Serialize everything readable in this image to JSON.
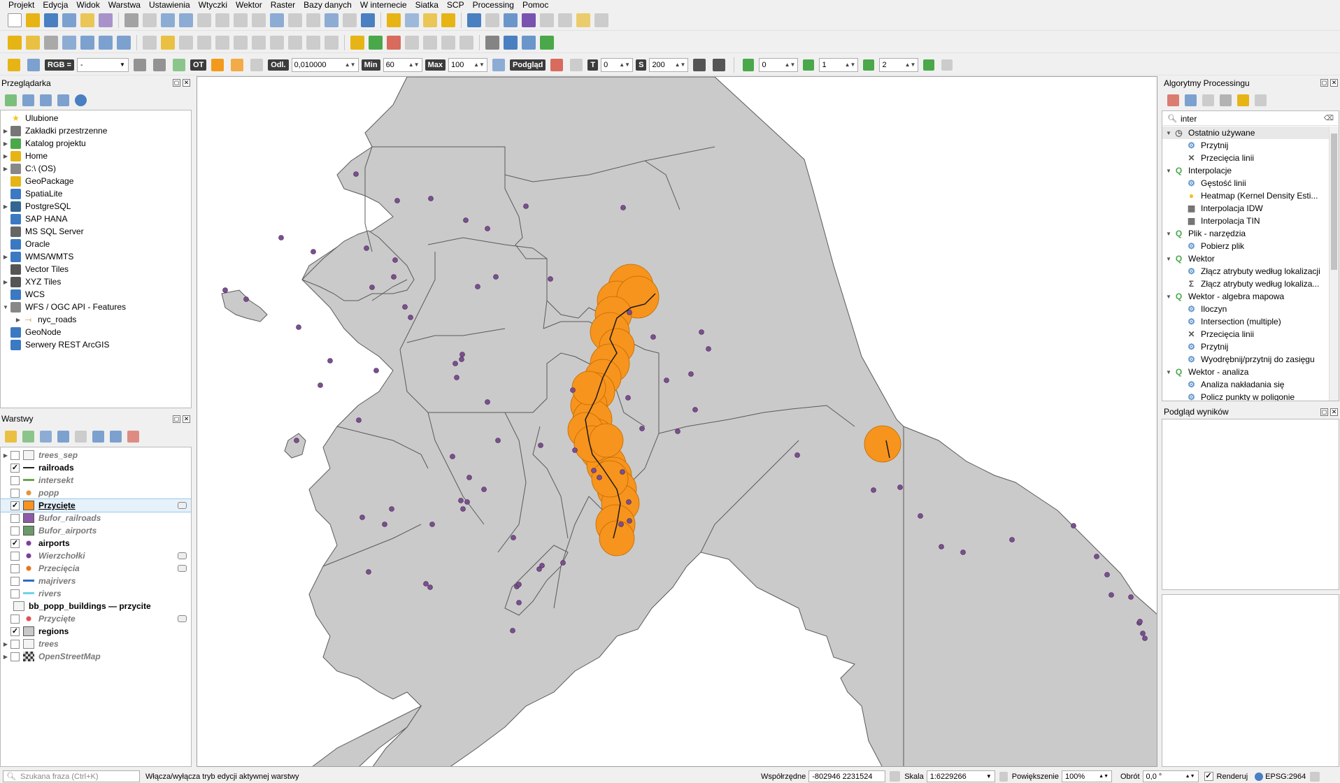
{
  "menu": [
    "Projekt",
    "Edycja",
    "Widok",
    "Warstwa",
    "Ustawienia",
    "Wtyczki",
    "Wektor",
    "Raster",
    "Bazy danych",
    "W internecie",
    "Siatka",
    "SCP",
    "Processing",
    "Pomoc"
  ],
  "toolbar3": {
    "rgb_label": "RGB =",
    "rgb_value": "-",
    "ot_label": "OT",
    "odl_label": "Odl.",
    "odl_value": "0,010000",
    "min_label": "Min",
    "min_value": "60",
    "max_label": "Max",
    "max_value": "100",
    "podglad_label": "Podgląd",
    "t_label": "T",
    "t_value": "0",
    "s_label": "S",
    "s_value": "200",
    "field_a": "0",
    "field_b": "1",
    "field_c": "2"
  },
  "browser": {
    "title": "Przeglądarka",
    "items": [
      {
        "label": "Ulubione",
        "icon": "star-icon",
        "expandable": false
      },
      {
        "label": "Zakładki przestrzenne",
        "icon": "bookmark-icon",
        "expandable": true
      },
      {
        "label": "Katalog projektu",
        "icon": "project-folder-icon",
        "expandable": true
      },
      {
        "label": "Home",
        "icon": "folder-icon",
        "expandable": true
      },
      {
        "label": "C:\\ (OS)",
        "icon": "drive-icon",
        "expandable": true
      },
      {
        "label": "GeoPackage",
        "icon": "geopackage-icon",
        "expandable": false
      },
      {
        "label": "SpatiaLite",
        "icon": "spatialite-icon",
        "expandable": false
      },
      {
        "label": "PostgreSQL",
        "icon": "postgresql-icon",
        "expandable": true
      },
      {
        "label": "SAP HANA",
        "icon": "sap-hana-icon",
        "expandable": false
      },
      {
        "label": "MS SQL Server",
        "icon": "mssql-icon",
        "expandable": false
      },
      {
        "label": "Oracle",
        "icon": "oracle-icon",
        "expandable": false
      },
      {
        "label": "WMS/WMTS",
        "icon": "wms-icon",
        "expandable": true
      },
      {
        "label": "Vector Tiles",
        "icon": "vector-tiles-icon",
        "expandable": false
      },
      {
        "label": "XYZ Tiles",
        "icon": "xyz-tiles-icon",
        "expandable": true
      },
      {
        "label": "WCS",
        "icon": "wcs-icon",
        "expandable": false
      },
      {
        "label": "WFS / OGC API - Features",
        "icon": "wfs-icon",
        "expandable": true,
        "expanded": true
      },
      {
        "label": "nyc_roads",
        "icon": "line-layer-icon",
        "expandable": true,
        "child": true
      },
      {
        "label": "GeoNode",
        "icon": "geonode-icon",
        "expandable": false
      },
      {
        "label": "Serwery REST ArcGIS",
        "icon": "arcgis-icon",
        "expandable": false
      }
    ]
  },
  "layers": {
    "title": "Warstwy",
    "items": [
      {
        "label": "trees_sep",
        "checked": false,
        "style": "normal",
        "icon": "group",
        "color": "#888888",
        "expand": true
      },
      {
        "label": "railroads",
        "checked": true,
        "style": "bold",
        "icon": "rail",
        "color": "#222222"
      },
      {
        "label": "intersekt",
        "checked": false,
        "style": "ital",
        "icon": "line",
        "color": "#6aa84f"
      },
      {
        "label": "popp",
        "checked": false,
        "style": "ital",
        "icon": "dot",
        "color": "#e69138"
      },
      {
        "label": "Przycięte",
        "checked": true,
        "style": "bold-u",
        "icon": "fill",
        "color": "#f7931e",
        "indicator": true,
        "selected": true
      },
      {
        "label": "Bufor_railroads",
        "checked": false,
        "style": "ital",
        "icon": "fill",
        "color": "#8e5aa8"
      },
      {
        "label": "Bufor_airports",
        "checked": false,
        "style": "ital",
        "icon": "fill",
        "color": "#6a9a6a"
      },
      {
        "label": "airports",
        "checked": true,
        "style": "bold",
        "icon": "dot",
        "color": "#7b3f98"
      },
      {
        "label": "Wierzchołki",
        "checked": false,
        "style": "ital",
        "icon": "dot",
        "color": "#7b3f98",
        "indicator": true
      },
      {
        "label": "Przecięcia",
        "checked": false,
        "style": "ital",
        "icon": "dot",
        "color": "#e8741b",
        "indicator": true
      },
      {
        "label": "majrivers",
        "checked": false,
        "style": "ital",
        "icon": "line",
        "color": "#2a6dc8"
      },
      {
        "label": "rivers",
        "checked": false,
        "style": "ital",
        "icon": "line",
        "color": "#6fd3e8"
      },
      {
        "label": "bb_popp_buildings — przycite",
        "checked": null,
        "style": "bold",
        "icon": "group2",
        "color": "#888888"
      },
      {
        "label": "Przycięte",
        "checked": false,
        "style": "ital",
        "icon": "dot",
        "color": "#e05050",
        "indicator": true
      },
      {
        "label": "regions",
        "checked": true,
        "style": "bold",
        "icon": "fill",
        "color": "#c8c8c8"
      },
      {
        "label": "trees",
        "checked": false,
        "style": "ital",
        "icon": "group",
        "color": "#888888",
        "expand": true
      },
      {
        "label": "OpenStreetMap",
        "checked": false,
        "style": "ital",
        "icon": "osm",
        "color": "#555555",
        "expand": true
      }
    ]
  },
  "processing": {
    "title": "Algorytmy Processingu",
    "search_value": "inter",
    "items": [
      {
        "label": "Ostatnio używane",
        "level": 0,
        "icon": "clock-icon",
        "expand": "open",
        "highlight": true
      },
      {
        "label": "Przytnij",
        "level": 1,
        "icon": "gear-icon"
      },
      {
        "label": "Przecięcia linii",
        "level": 1,
        "icon": "cross-lines-icon"
      },
      {
        "label": "Interpolacje",
        "level": 0,
        "icon": "qgis-icon",
        "expand": "open"
      },
      {
        "label": "Gęstość linii",
        "level": 1,
        "icon": "gear-icon"
      },
      {
        "label": "Heatmap (Kernel Density Esti...",
        "level": 1,
        "icon": "heatmap-icon"
      },
      {
        "label": "Interpolacja IDW",
        "level": 1,
        "icon": "raster-icon"
      },
      {
        "label": "Interpolacja TIN",
        "level": 1,
        "icon": "raster-icon"
      },
      {
        "label": "Plik - narzędzia",
        "level": 0,
        "icon": "qgis-icon",
        "expand": "open"
      },
      {
        "label": "Pobierz plik",
        "level": 1,
        "icon": "gear-icon"
      },
      {
        "label": "Wektor",
        "level": 0,
        "icon": "qgis-icon",
        "expand": "open"
      },
      {
        "label": "Złącz atrybuty według lokalizacji",
        "level": 1,
        "icon": "gear-icon"
      },
      {
        "label": "Złącz atrybuty według lokaliza...",
        "level": 1,
        "icon": "sigma-icon"
      },
      {
        "label": "Wektor - algebra mapowa",
        "level": 0,
        "icon": "qgis-icon",
        "expand": "open"
      },
      {
        "label": "Iloczyn",
        "level": 1,
        "icon": "gear-icon"
      },
      {
        "label": "Intersection (multiple)",
        "level": 1,
        "icon": "gear-icon"
      },
      {
        "label": "Przecięcia linii",
        "level": 1,
        "icon": "cross-lines-icon"
      },
      {
        "label": "Przytnij",
        "level": 1,
        "icon": "gear-icon"
      },
      {
        "label": "Wyodrębnij/przytnij do zasięgu",
        "level": 1,
        "icon": "gear-icon"
      },
      {
        "label": "Wektor - analiza",
        "level": 0,
        "icon": "qgis-icon",
        "expand": "open"
      },
      {
        "label": "Analiza nakładania się",
        "level": 1,
        "icon": "gear-icon"
      },
      {
        "label": "Policz punkty w poligonie",
        "level": 1,
        "icon": "gear-icon"
      }
    ]
  },
  "results": {
    "title": "Podgląd wyników"
  },
  "status": {
    "search_placeholder": "Szukana fraza (Ctrl+K)",
    "message": "Włącza/wyłącza tryb edycji aktywnej warstwy",
    "coord_label": "Współrzędne",
    "coord_value": "-802946 2231524",
    "scale_label": "Skala",
    "scale_value": "1:6229266",
    "zoom_label": "Powiększenie",
    "zoom_value": "100%",
    "rotation_label": "Obrót",
    "rotation_value": "0,0 °",
    "render_label": "Renderuj",
    "crs_label": "EPSG:2964"
  },
  "colors": {
    "land": "#cacaca",
    "border": "#5a5a5a",
    "airport": "#7b4f8f",
    "clip": "#f7941d",
    "rail": "#1a1a1a"
  }
}
